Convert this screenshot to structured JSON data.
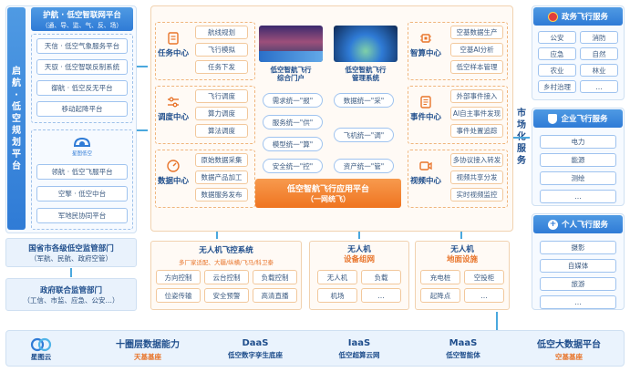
{
  "left": {
    "vertical_title": [
      "启",
      "航",
      "·",
      "低",
      "空",
      "规",
      "划",
      "平",
      "台"
    ],
    "header_title": "护航 · 低空智联网平台",
    "header_subtitle": "（通、导、监、气、反、场）",
    "upper_items": [
      "天信 · 低空气象服务平台",
      "天驭 · 低空智联反制系统",
      "御航 · 低空反无平台",
      "移动起降平台"
    ],
    "logo_text": "星图低空",
    "lower_items": [
      "领航 · 低空飞服平台",
      "空擎 · 低空中台",
      "军地民协同平台"
    ],
    "national": {
      "title": "国省市各级低空监管部门",
      "subtitle": "（军航、民航、政府空管）"
    },
    "gov": {
      "title": "政府联合监管部门",
      "subtitle": "（工信、市监、应急、公安…）"
    }
  },
  "center": {
    "rows": [
      {
        "center": "任务中心",
        "icon": "task-icon",
        "items": [
          "航线规划",
          "飞行模拟",
          "任务下发"
        ]
      },
      {
        "center": "调度中心",
        "icon": "sliders-icon",
        "items": [
          "飞行调度",
          "算力调度",
          "算法调度"
        ]
      },
      {
        "center": "数据中心",
        "icon": "gauge-icon",
        "items": [
          "原始数据采集",
          "数据产品加工",
          "数据服务发布"
        ]
      }
    ],
    "portals": [
      {
        "label": "低空智航飞行\n综合门户"
      },
      {
        "label": "低空智航飞行\n管理系统"
      }
    ],
    "pills": [
      [
        "需求统一\"报\"",
        "数据统一\"采\""
      ],
      [
        "服务统一\"供\"",
        "飞机统一\"调\""
      ],
      [
        "模型统一\"算\""
      ],
      [
        "安全统一\"控\"",
        "资产统一\"管\""
      ]
    ],
    "platform_title": "低空智航飞行应用平台",
    "platform_subtitle": "（一网统飞）",
    "right_rows": [
      {
        "center": "智算中心",
        "icon": "chip-icon",
        "items": [
          "空基数据生产",
          "空基AI分析",
          "低空样本管理"
        ]
      },
      {
        "center": "事件中心",
        "icon": "doc-icon",
        "items": [
          "外部事件接入",
          "AI自主事件发现",
          "事件处置追踪"
        ]
      },
      {
        "center": "视频中心",
        "icon": "camera-icon",
        "items": [
          "多协议接入转发",
          "视频共享分发",
          "实时视频监控"
        ]
      }
    ]
  },
  "bottom_mid": {
    "flight": {
      "title": "无人机飞控系统",
      "subtitle": "多厂家适配、大疆/纵横/飞马/科卫泰",
      "items": [
        "方向控制",
        "云台控制",
        "负载控制",
        "位姿传输",
        "安全预警",
        "高清直播"
      ]
    },
    "equipment": {
      "title": "无人机",
      "title2": "设备组网",
      "items": [
        "无人机",
        "负载",
        "机场",
        "…"
      ]
    },
    "ground": {
      "title": "无人机",
      "title2": "地面设施",
      "items": [
        "充电桩",
        "空投柜",
        "起降点",
        "…"
      ]
    }
  },
  "market_label": [
    "市",
    "场",
    "化",
    "服",
    "务"
  ],
  "right": {
    "gov": {
      "title": "政务飞行服务",
      "items": [
        "公安",
        "消防",
        "应急",
        "自然",
        "农业",
        "林业",
        "乡村治理",
        "…"
      ]
    },
    "enterprise": {
      "title": "企业飞行服务",
      "items": [
        "电力",
        "能源",
        "测绘",
        "…"
      ]
    },
    "personal": {
      "title": "个人飞行服务",
      "items": [
        "摄影",
        "自媒体",
        "旅游",
        "…"
      ]
    }
  },
  "footer": {
    "logo_text": "星图云",
    "items": [
      {
        "title": "十圈层数据能力",
        "sub": "天基基座",
        "sub_color": "#e8742a"
      },
      {
        "title": "DaaS",
        "sub": "低空数字孪生底座",
        "sub_color": "#1f4e8c"
      },
      {
        "title": "IaaS",
        "sub": "低空超算云网",
        "sub_color": "#1f4e8c"
      },
      {
        "title": "MaaS",
        "sub": "低空智能体",
        "sub_color": "#1f4e8c"
      },
      {
        "title": "低空大数据平台",
        "sub": "空基基座",
        "sub_color": "#e8742a"
      }
    ]
  }
}
